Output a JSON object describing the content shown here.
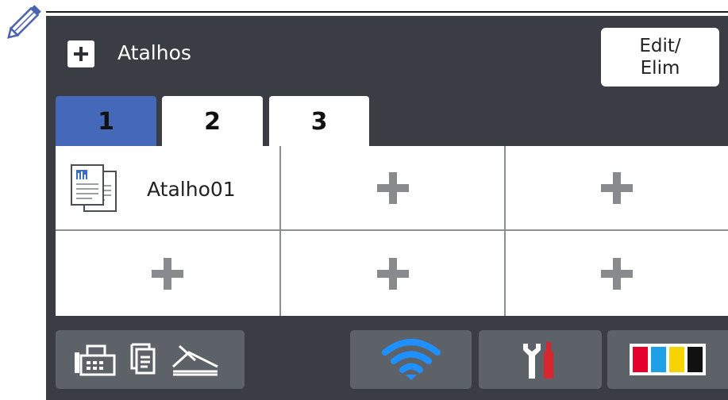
{
  "header": {
    "title": "Atalhos"
  },
  "edit_button": {
    "line1": "Edit/",
    "line2": "Elim"
  },
  "tabs": [
    {
      "label": "1",
      "active": true
    },
    {
      "label": "2",
      "active": false
    },
    {
      "label": "3",
      "active": false
    }
  ],
  "shortcuts": {
    "cells": [
      {
        "label": "Atalho01",
        "icon": "copy-document-icon"
      },
      {
        "label": "",
        "icon": "plus-icon"
      },
      {
        "label": "",
        "icon": "plus-icon"
      },
      {
        "label": "",
        "icon": "plus-icon"
      },
      {
        "label": "",
        "icon": "plus-icon"
      },
      {
        "label": "",
        "icon": "plus-icon"
      }
    ]
  },
  "bottom_bar": {
    "modes_icons": [
      "fax-icon",
      "copy-icon",
      "scan-icon"
    ],
    "wifi_icon": "wifi-icon",
    "settings_icon": "tools-icon",
    "ink_icon": "ink-cartridges-icon",
    "ink_colors": [
      "#e4002b",
      "#1ea0e6",
      "#f5d400",
      "#111111"
    ]
  },
  "colors": {
    "screen_bg": "#3a3e44",
    "active_tab": "#4668b8",
    "wifi": "#1e90ff",
    "tool_red": "#d9262e"
  }
}
